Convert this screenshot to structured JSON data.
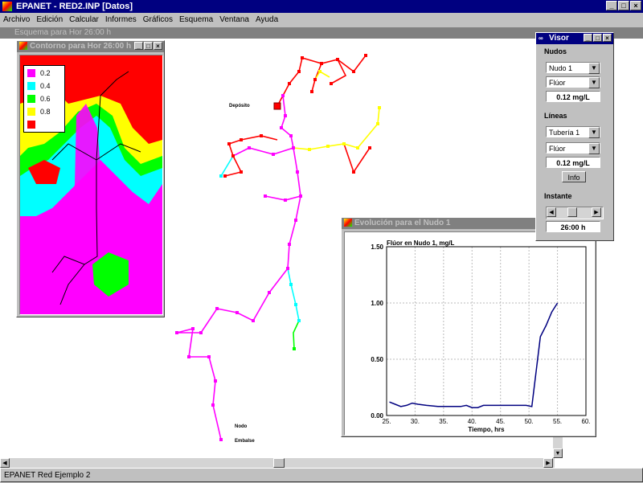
{
  "app": {
    "title": "EPANET - RED2.INP [Datos]",
    "minimize": "_",
    "maximize": "□",
    "close": "×"
  },
  "menu": [
    "Archivo",
    "Edición",
    "Calcular",
    "Informes",
    "Gráficos",
    "Esquema",
    "Ventana",
    "Ayuda"
  ],
  "map": {
    "title": "Esquema para Hor 26:00 h",
    "labels": {
      "deposito": "Depósito",
      "nodo": "Nodo",
      "embalse": "Embalse"
    },
    "colors": {
      "c02": "#ff00ff",
      "c04": "#00ffff",
      "c06": "#00ff00",
      "c08": "#ffff00",
      "c10": "#ff0000"
    }
  },
  "overview": {
    "title": "Contorno para Hor 26:00 h",
    "legend": [
      {
        "label": "0.2",
        "color": "#ff00ff"
      },
      {
        "label": "0.4",
        "color": "#00ffff"
      },
      {
        "label": "0.6",
        "color": "#00ff00"
      },
      {
        "label": "0.8",
        "color": "#ffff00"
      },
      {
        "label": "",
        "color": "#ff0000"
      }
    ]
  },
  "graph": {
    "title": "Evolución para el Nudo 1"
  },
  "chart_data": {
    "type": "line",
    "title": "Flúor en Nudo 1, mg/L",
    "xlabel": "Tiempo, hrs",
    "ylabel": "",
    "xlim": [
      25,
      60
    ],
    "ylim": [
      0,
      1.5
    ],
    "xticks": [
      "25.",
      "30.",
      "35.",
      "40.",
      "45.",
      "50.",
      "55.",
      "60."
    ],
    "yticks": [
      "0.00",
      "0.50",
      "1.00",
      "1.50"
    ],
    "grid": true,
    "series": [
      {
        "color": "#000080",
        "x": [
          25.5,
          26.5,
          27.5,
          28.5,
          29.5,
          30.5,
          32,
          34,
          36,
          38,
          39,
          40,
          41,
          42,
          44,
          46,
          48,
          49.5,
          50.5,
          52,
          53,
          54,
          55
        ],
        "y": [
          0.12,
          0.1,
          0.08,
          0.09,
          0.11,
          0.1,
          0.09,
          0.08,
          0.08,
          0.08,
          0.09,
          0.07,
          0.07,
          0.09,
          0.09,
          0.09,
          0.09,
          0.09,
          0.08,
          0.7,
          0.8,
          0.92,
          1.0
        ]
      }
    ]
  },
  "browser": {
    "title": "Visor",
    "nodes_label": "Nudos",
    "node_select": "Nudo 1",
    "node_param": "Flúor",
    "node_value": "0.12 mg/L",
    "links_label": "Líneas",
    "link_select": "Tubería 1",
    "link_param": "Flúor",
    "link_value": "0.12 mg/L",
    "info_button": "Info",
    "time_label": "Instante",
    "time_value": "26:00 h"
  },
  "status": {
    "text": "EPANET Red Ejemplo 2"
  }
}
